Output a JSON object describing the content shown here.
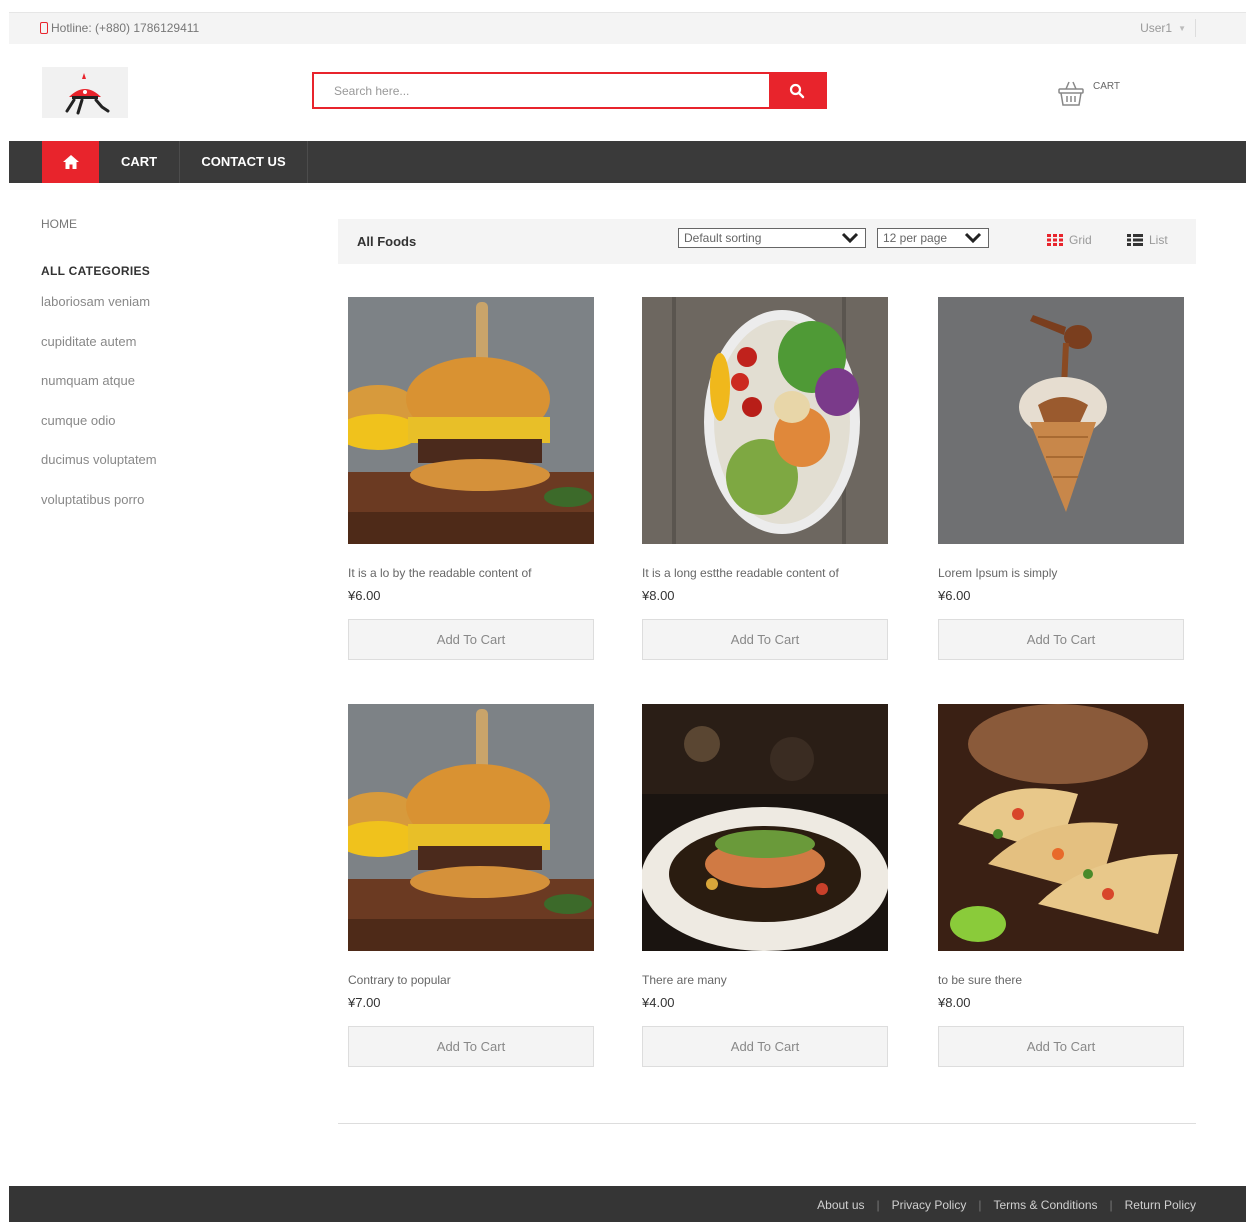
{
  "topbar": {
    "hotline": "Hotline: (+880) 1786129411",
    "user": "User1"
  },
  "header": {
    "search_placeholder": "Search here...",
    "cart_label": "CART"
  },
  "nav": {
    "items": [
      {
        "label": "CART"
      },
      {
        "label": "CONTACT US"
      }
    ]
  },
  "sidebar": {
    "home": "HOME",
    "heading": "ALL CATEGORIES",
    "categories": [
      "laboriosam veniam",
      "cupiditate autem",
      "numquam atque",
      "cumque odio",
      "ducimus voluptatem",
      "voluptatibus porro"
    ]
  },
  "toolbar": {
    "title": "All Foods",
    "sorting": "Default sorting",
    "per_page": "12 per page",
    "grid_label": "Grid",
    "list_label": "List"
  },
  "products": [
    {
      "name": "It is a lo by the readable content of",
      "price": "¥6.00",
      "button": "Add To Cart"
    },
    {
      "name": "It is a long estthe readable content of",
      "price": "¥8.00",
      "button": "Add To Cart"
    },
    {
      "name": "Lorem Ipsum is simply",
      "price": "¥6.00",
      "button": "Add To Cart"
    },
    {
      "name": "Contrary to popular",
      "price": "¥7.00",
      "button": "Add To Cart"
    },
    {
      "name": "There are many",
      "price": "¥4.00",
      "button": "Add To Cart"
    },
    {
      "name": "to be sure there",
      "price": "¥8.00",
      "button": "Add To Cart"
    }
  ],
  "footer": {
    "links": [
      "About us",
      "Privacy Policy",
      "Terms & Conditions",
      "Return Policy"
    ]
  },
  "colors": {
    "accent": "#e8242c",
    "nav_bg": "#3a3a3a",
    "footer_bg": "#353535"
  }
}
